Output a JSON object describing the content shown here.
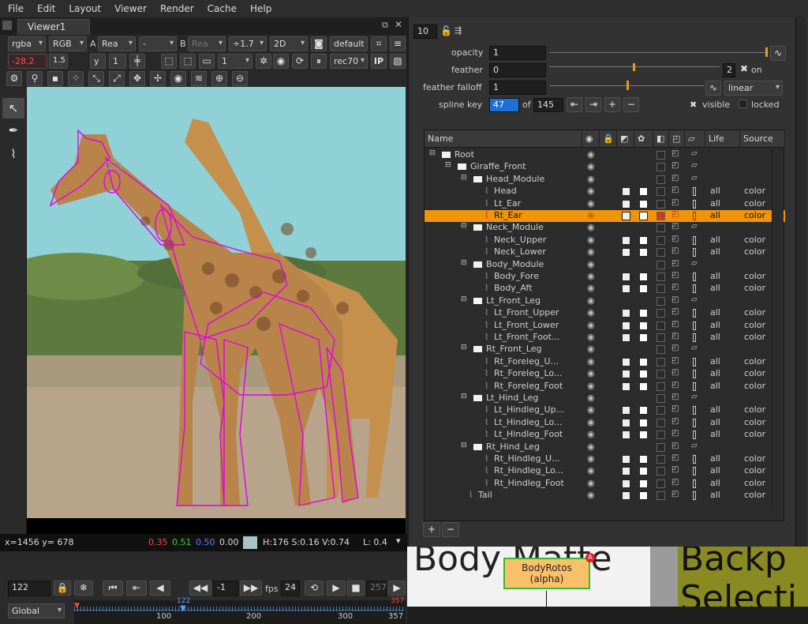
{
  "menu": [
    "File",
    "Edit",
    "Layout",
    "Viewer",
    "Render",
    "Cache",
    "Help"
  ],
  "viewer": {
    "tab_label": "Viewer1",
    "row1": {
      "channels": "rgba",
      "layer": "RGB",
      "a_label": "A",
      "a_input": "Rea",
      "a_op": "-",
      "b_label": "B",
      "b_input": "Rea",
      "gain": "÷1.7",
      "view": "2D",
      "lut": "default"
    },
    "row2": {
      "exposure": "-28.2",
      "fstop": "1.5",
      "gamma_label": "y",
      "gamma": "1",
      "frame": "1",
      "colorspace": "rec70",
      "ip": "IP"
    },
    "info": {
      "coords": "x=1456 y= 678",
      "r": "0.35",
      "g": "0.51",
      "b": "0.50",
      "a": "0.00",
      "hsv": "H:176 S:0.16 V:0.74",
      "l": "L: 0.4"
    },
    "playback": {
      "frame": "122",
      "inc": "-1",
      "fps_label": "fps",
      "fps": "24",
      "end": "257",
      "scope": "Global",
      "tick_labels": [
        "100",
        "200",
        "300",
        "357"
      ],
      "range_start": "",
      "range_end": "357",
      "current": "122"
    }
  },
  "props": {
    "version": "10",
    "opacity_label": "opacity",
    "opacity": "1",
    "feather_label": "feather",
    "feather": "0",
    "falloff_label": "feather falloff",
    "falloff": "1",
    "falloff_mode": "linear",
    "spline_key_label": "spline key",
    "spline_key": "47",
    "of_label": "of",
    "spline_total": "145",
    "feather_value2": "2",
    "on_label": "on",
    "visible_label": "visible",
    "locked_label": "locked",
    "opacity_scale": [
      "0",
      "0.01",
      "0.1",
      "0.2",
      "0.4",
      "0.6",
      "0.8"
    ],
    "feather_scale": [
      "-100",
      "-50",
      "-10",
      "0",
      "10",
      "50",
      "100"
    ],
    "falloff_scale": [
      "0.2",
      "0.3",
      "0.5",
      "1",
      "2",
      "3",
      "4",
      "5"
    ]
  },
  "tree": {
    "headers": {
      "name": "Name",
      "life": "Life",
      "source": "Source"
    },
    "rows": [
      {
        "name": "Root",
        "depth": 0,
        "type": "folder",
        "cols": false
      },
      {
        "name": "Giraffe_Front",
        "depth": 1,
        "type": "folder",
        "cols": false
      },
      {
        "name": "Head_Module",
        "depth": 2,
        "type": "folder",
        "cols": false
      },
      {
        "name": "Head",
        "depth": 3,
        "type": "shape",
        "cols": true,
        "life": "all",
        "source": "color"
      },
      {
        "name": "Lt_Ear",
        "depth": 3,
        "type": "shape",
        "cols": true,
        "life": "all",
        "source": "color"
      },
      {
        "name": "Rt_Ear",
        "depth": 3,
        "type": "shape",
        "cols": true,
        "life": "all",
        "source": "color",
        "selected": true
      },
      {
        "name": "Neck_Module",
        "depth": 2,
        "type": "folder",
        "cols": false
      },
      {
        "name": "Neck_Upper",
        "depth": 3,
        "type": "shape",
        "cols": true,
        "life": "all",
        "source": "color"
      },
      {
        "name": "Neck_Lower",
        "depth": 3,
        "type": "shape",
        "cols": true,
        "life": "all",
        "source": "color"
      },
      {
        "name": "Body_Module",
        "depth": 2,
        "type": "folder",
        "cols": false
      },
      {
        "name": "Body_Fore",
        "depth": 3,
        "type": "shape",
        "cols": true,
        "life": "all",
        "source": "color"
      },
      {
        "name": "Body_Aft",
        "depth": 3,
        "type": "shape",
        "cols": true,
        "life": "all",
        "source": "color"
      },
      {
        "name": "Lt_Front_Leg",
        "depth": 2,
        "type": "folder",
        "cols": false
      },
      {
        "name": "Lt_Front_Upper",
        "depth": 3,
        "type": "shape",
        "cols": true,
        "life": "all",
        "source": "color"
      },
      {
        "name": "Lt_Front_Lower",
        "depth": 3,
        "type": "shape",
        "cols": true,
        "life": "all",
        "source": "color"
      },
      {
        "name": "Lt_Front_Foot...",
        "depth": 3,
        "type": "shape",
        "cols": true,
        "life": "all",
        "source": "color"
      },
      {
        "name": "Rt_Front_Leg",
        "depth": 2,
        "type": "folder",
        "cols": false
      },
      {
        "name": "Rt_Foreleg_U...",
        "depth": 3,
        "type": "shape",
        "cols": true,
        "life": "all",
        "source": "color"
      },
      {
        "name": "Rt_Foreleg_Lo...",
        "depth": 3,
        "type": "shape",
        "cols": true,
        "life": "all",
        "source": "color"
      },
      {
        "name": "Rt_Foreleg_Foot",
        "depth": 3,
        "type": "shape",
        "cols": true,
        "life": "all",
        "source": "color"
      },
      {
        "name": "Lt_Hind_Leg",
        "depth": 2,
        "type": "folder",
        "cols": false
      },
      {
        "name": "Lt_Hindleg_Up...",
        "depth": 3,
        "type": "shape",
        "cols": true,
        "life": "all",
        "source": "color"
      },
      {
        "name": "Lt_Hindleg_Lo...",
        "depth": 3,
        "type": "shape",
        "cols": true,
        "life": "all",
        "source": "color"
      },
      {
        "name": "Lt_Hindleg_Foot",
        "depth": 3,
        "type": "shape",
        "cols": true,
        "life": "all",
        "source": "color"
      },
      {
        "name": "Rt_Hind_Leg",
        "depth": 2,
        "type": "folder",
        "cols": false
      },
      {
        "name": "Rt_Hindleg_U...",
        "depth": 3,
        "type": "shape",
        "cols": true,
        "life": "all",
        "source": "color"
      },
      {
        "name": "Rt_Hindleg_Lo...",
        "depth": 3,
        "type": "shape",
        "cols": true,
        "life": "all",
        "source": "color"
      },
      {
        "name": "Rt_Hindleg_Foot",
        "depth": 3,
        "type": "shape",
        "cols": true,
        "life": "all",
        "source": "color"
      },
      {
        "name": "Tail",
        "depth": 2,
        "type": "shape",
        "cols": true,
        "life": "all",
        "source": "color"
      }
    ],
    "add_label": "+",
    "remove_label": "−"
  },
  "nodegraph": {
    "left_text": "Body Matte",
    "node_label_1": "BodyRotos",
    "node_label_2": "(alpha)",
    "right_text": "Backp",
    "right_text2": "Selecti",
    "badge": "A"
  },
  "colors": {
    "accent": "#f0950a",
    "roto": "#e100e6",
    "sky": "#8fd1d6"
  }
}
